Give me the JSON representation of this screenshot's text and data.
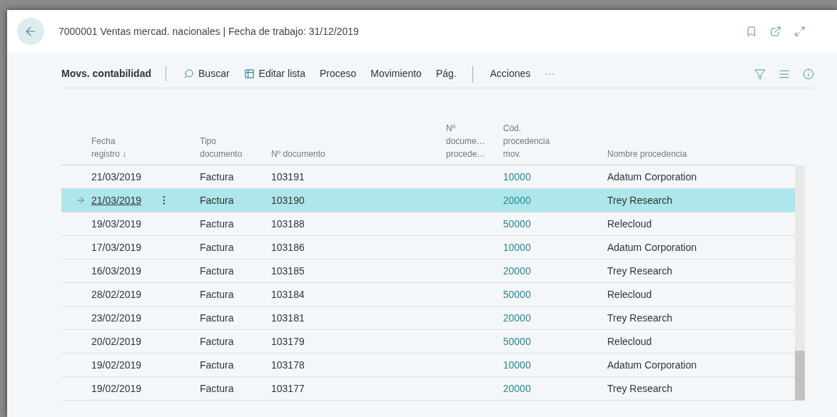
{
  "window": {
    "title": "7000001 Ventas mercad. nacionales | Fecha de trabajo: 31/12/2019"
  },
  "toolbar": {
    "title": "Movs. contabilidad",
    "actions": [
      {
        "kind": "search",
        "label": "Buscar"
      },
      {
        "kind": "edit",
        "label": "Editar lista"
      },
      {
        "kind": "plain",
        "label": "Proceso"
      },
      {
        "kind": "plain",
        "label": "Movimiento"
      },
      {
        "kind": "plain",
        "label": "Pág."
      },
      {
        "kind": "divider",
        "label": "Acciones"
      },
      {
        "kind": "plain",
        "label": "···"
      }
    ]
  },
  "table": {
    "columns": [
      "Fecha registro ↓",
      "Tipo documento",
      "Nº documento",
      "Nº docume… procede…",
      "Cód. procedencia mov.",
      "Nombre procedencia"
    ],
    "rows": [
      {
        "selected": false,
        "cells": [
          "21/03/2019",
          "Factura",
          "103191",
          "",
          "10000",
          "Adatum Corporation"
        ]
      },
      {
        "selected": true,
        "cells": [
          "21/03/2019",
          "Factura",
          "103190",
          "",
          "20000",
          "Trey Research"
        ]
      },
      {
        "selected": false,
        "cells": [
          "19/03/2019",
          "Factura",
          "103188",
          "",
          "50000",
          "Relecloud"
        ]
      },
      {
        "selected": false,
        "cells": [
          "17/03/2019",
          "Factura",
          "103186",
          "",
          "10000",
          "Adatum Corporation"
        ]
      },
      {
        "selected": false,
        "cells": [
          "16/03/2019",
          "Factura",
          "103185",
          "",
          "20000",
          "Trey Research"
        ]
      },
      {
        "selected": false,
        "cells": [
          "28/02/2019",
          "Factura",
          "103184",
          "",
          "50000",
          "Relecloud"
        ]
      },
      {
        "selected": false,
        "cells": [
          "23/02/2019",
          "Factura",
          "103181",
          "",
          "20000",
          "Trey Research"
        ]
      },
      {
        "selected": false,
        "cells": [
          "20/02/2019",
          "Factura",
          "103179",
          "",
          "50000",
          "Relecloud"
        ]
      },
      {
        "selected": false,
        "cells": [
          "19/02/2019",
          "Factura",
          "103178",
          "",
          "10000",
          "Adatum Corporation"
        ]
      },
      {
        "selected": false,
        "cells": [
          "19/02/2019",
          "Factura",
          "103177",
          "",
          "20000",
          "Trey Research"
        ]
      }
    ]
  }
}
